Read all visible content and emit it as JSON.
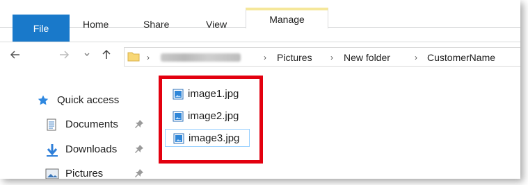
{
  "ribbon": {
    "tabs": [
      {
        "label": "File"
      },
      {
        "label": "Home"
      },
      {
        "label": "Share"
      },
      {
        "label": "View"
      },
      {
        "label": "Manage"
      }
    ]
  },
  "nav": {
    "back_icon": "back-arrow-icon",
    "forward_icon": "forward-arrow-icon",
    "recent_icon": "chevron-down-icon",
    "up_icon": "up-arrow-icon"
  },
  "address": {
    "crumbs": [
      "Pictures",
      "New folder",
      "CustomerName"
    ],
    "separator": "›"
  },
  "navpane": {
    "items": [
      {
        "label": "Quick access",
        "icon": "star-icon"
      },
      {
        "label": "Documents",
        "icon": "documents-icon",
        "pinned": true
      },
      {
        "label": "Downloads",
        "icon": "download-icon",
        "pinned": true
      },
      {
        "label": "Pictures",
        "icon": "pictures-icon",
        "pinned": true
      }
    ]
  },
  "files": [
    {
      "name": "image1.jpg",
      "icon": "image-file-icon"
    },
    {
      "name": "image2.jpg",
      "icon": "image-file-icon"
    },
    {
      "name": "image3.jpg",
      "icon": "image-file-icon",
      "selected": true
    }
  ],
  "colors": {
    "file_tab": "#1979ca",
    "manage_accent": "#f5e79a",
    "highlight_box": "#e3000f",
    "selection_border": "#99d1ff"
  }
}
